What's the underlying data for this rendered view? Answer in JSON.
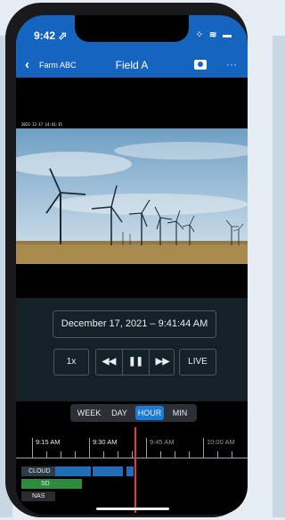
{
  "status": {
    "time": "9:42 ⬀",
    "icons": "⁘ ≋ ▬"
  },
  "nav": {
    "back_label": "Farm ABC",
    "title": "Field A"
  },
  "video": {
    "overlay_timestamp": "2021-12-17 14:41:35"
  },
  "player": {
    "datetime": "December 17, 2021  –  9:41:44 AM",
    "speed": "1x",
    "rewind": "◀◀",
    "pause": "❚❚",
    "forward": "▶▶",
    "live": "LIVE"
  },
  "zoom": {
    "options": [
      "WEEK",
      "DAY",
      "HOUR",
      "MIN"
    ],
    "selected": "HOUR"
  },
  "timeline": {
    "ticks": [
      "9:15 AM",
      "9:30 AM",
      "9:45 AM",
      "10:00 AM"
    ],
    "tracks": {
      "cloud": "CLOUD",
      "sd": "SD",
      "nas": "NAS"
    }
  },
  "colors": {
    "accent": "#1565c0",
    "active": "#1e7ad6",
    "playhead": "#e53935",
    "sd": "#2e8b3e"
  }
}
